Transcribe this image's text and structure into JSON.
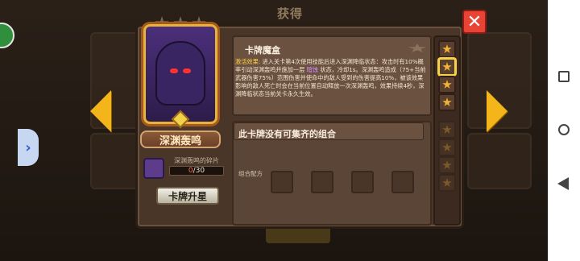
{
  "header": {
    "title": "获得"
  },
  "card": {
    "name": "深渊轰鸣",
    "star_count": 3,
    "fragment_label": "深渊轰鸣的碎片",
    "fragments_current": "0",
    "fragments_max": "/30",
    "upgrade_label": "卡牌升星"
  },
  "info": {
    "title": "卡牌魔盒",
    "desc_prefix": "激活效果:",
    "desc_1": "进入关卡第4次使用技能后进入深渊降临状态：攻击时有10%概率引动深渊轰鸣并施加一层",
    "desc_hl": "暗蚀",
    "desc_2": "状态，冷却1s。深渊轰鸣造成（75+当前武器伤害75%）范围伤害并使命中的敌人受到的伤害提高10%，被该效果影响的敌人死亡时会在当前位置自动释放一次深渊轰鸣，效果持续4秒，深渊降临状态当前关卡永久生效。"
  },
  "combo": {
    "message": "此卡牌没有可集齐的组合",
    "recipe_label": "组合配方"
  },
  "icons": {
    "close": "close-icon",
    "prev": "arrow-left-icon",
    "next": "arrow-right-icon"
  },
  "colors": {
    "accent_gold": "#f4b51a",
    "close_red": "#e84436",
    "highlight_purple": "#d38dff"
  }
}
